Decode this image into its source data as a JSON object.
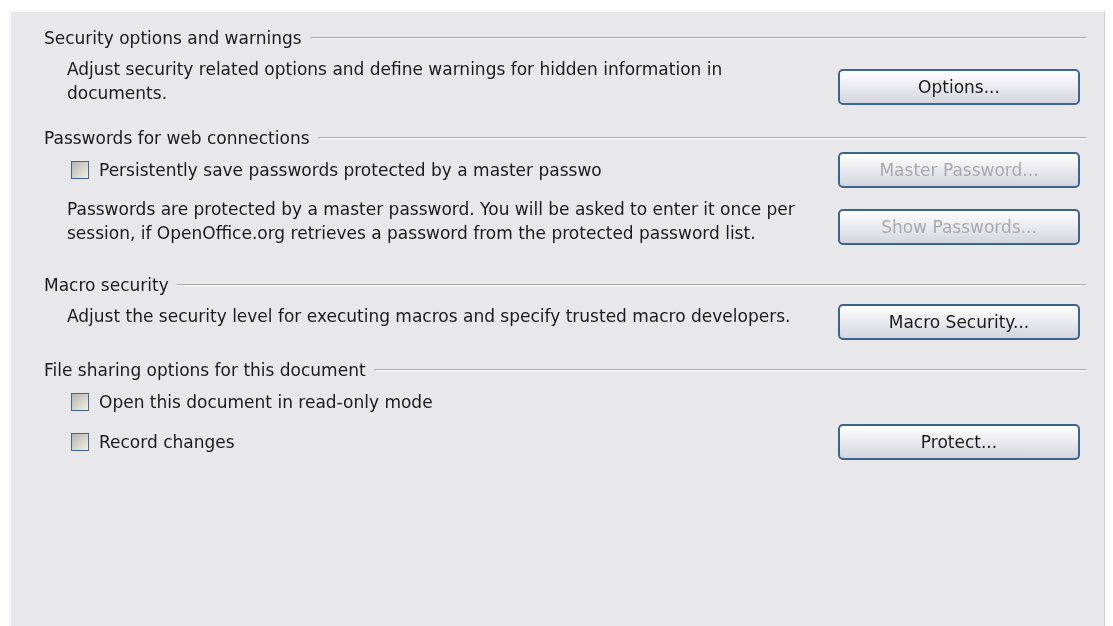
{
  "sections": [
    {
      "heading": "Security options and warnings",
      "rows": [
        {
          "kind": "text",
          "text": "Adjust security related options and define warnings for hidden information in documents.",
          "button": {
            "label": "Options...",
            "disabled": false
          }
        }
      ]
    },
    {
      "heading": "Passwords for web connections",
      "rows": [
        {
          "kind": "checkbox",
          "text": "Persistently save passwords protected by a master passwo",
          "checked": false,
          "button": {
            "label": "Master Password...",
            "disabled": true
          }
        },
        {
          "kind": "text",
          "text": "Passwords are protected by a master password. You will be asked to enter it once per session, if OpenOffice.org retrieves a password from the protected password list.",
          "button": {
            "label": "Show Passwords...",
            "disabled": true
          }
        }
      ]
    },
    {
      "heading": "Macro security",
      "rows": [
        {
          "kind": "text",
          "text": "Adjust the security level for executing macros and specify trusted macro developers.",
          "button": {
            "label": "Macro Security...",
            "disabled": false
          }
        }
      ]
    },
    {
      "heading": "File sharing options for this document",
      "rows": [
        {
          "kind": "checkbox",
          "text": "Open this document in read-only mode",
          "checked": false
        },
        {
          "kind": "checkbox",
          "text": "Record changes",
          "checked": false,
          "button": {
            "label": "Protect...",
            "disabled": false
          }
        }
      ]
    }
  ]
}
